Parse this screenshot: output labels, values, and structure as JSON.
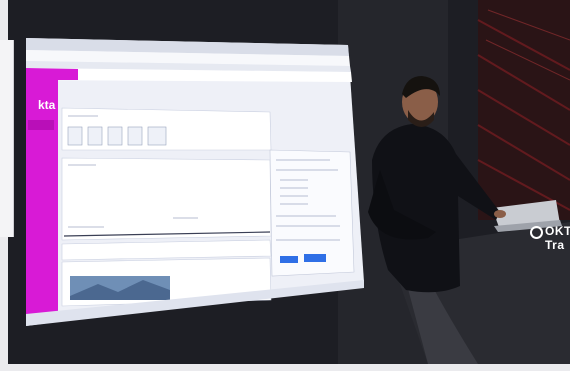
{
  "photo": {
    "subject": "presenter",
    "podium_brand": "OKT Tra",
    "screen_logo": "kta"
  },
  "colors": {
    "screen_accent": "#d81ad6",
    "podium": "#2a2b31",
    "laptop": "#c9ccd2",
    "wall": "#1d1e24"
  }
}
